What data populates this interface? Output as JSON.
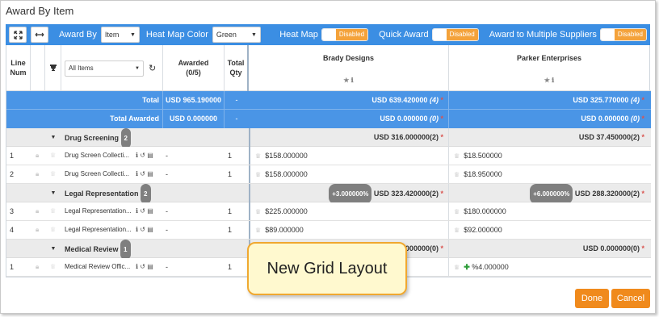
{
  "window": {
    "title": "Award By Item"
  },
  "toolbar": {
    "award_by_label": "Award By",
    "award_by_value": "Item",
    "heat_map_color_label": "Heat Map Color",
    "heat_map_color_value": "Green",
    "toggles": [
      {
        "label": "Heat Map",
        "state": "Disabled"
      },
      {
        "label": "Quick Award",
        "state": "Disabled"
      },
      {
        "label": "Award to Multiple Suppliers",
        "state": "Disabled"
      }
    ]
  },
  "grid": {
    "headers": {
      "line_num": "Line Num",
      "filter_value": "All Items",
      "awarded": "Awarded",
      "awarded_count": "(0/5)",
      "total_qty": "Total Qty"
    },
    "suppliers": [
      "Brady Designs",
      "Parker Enterprises"
    ],
    "total_row": {
      "label": "Total",
      "value": "USD 965.190000",
      "qty": "-",
      "suppliers": [
        "USD 639.420000",
        "USD 325.770000"
      ],
      "supplier_counts": [
        "(4)",
        "(4)"
      ]
    },
    "total_awarded_row": {
      "label": "Total Awarded",
      "value": "USD 0.000000",
      "qty": "-",
      "suppliers": [
        "USD 0.000000",
        "USD 0.000000"
      ],
      "supplier_counts": [
        "(0)",
        "(0)"
      ]
    },
    "groups": [
      {
        "name": "Drug Screening",
        "count": "2",
        "supplier_totals": [
          "USD 316.000000(2)",
          "USD 37.450000(2)"
        ],
        "supplier_badges": [
          "",
          ""
        ],
        "items": [
          {
            "line": "1",
            "name": "Drug Screen Collecti...",
            "awarded": "-",
            "qty": "1",
            "prices": [
              "$158.000000",
              "$18.500000"
            ]
          },
          {
            "line": "2",
            "name": "Drug Screen Collecti...",
            "awarded": "-",
            "qty": "1",
            "prices": [
              "$158.000000",
              "$18.950000"
            ]
          }
        ]
      },
      {
        "name": "Legal Representation",
        "count": "2",
        "supplier_totals": [
          "USD 323.420000(2)",
          "USD 288.320000(2)"
        ],
        "supplier_badges": [
          "+3.000000%",
          "+6.000000%"
        ],
        "items": [
          {
            "line": "3",
            "name": "Legal Representation...",
            "awarded": "-",
            "qty": "1",
            "prices": [
              "$225.000000",
              "$180.000000"
            ]
          },
          {
            "line": "4",
            "name": "Legal Representation...",
            "awarded": "-",
            "qty": "1",
            "prices": [
              "$89.000000",
              "$92.000000"
            ]
          }
        ]
      },
      {
        "name": "Medical Review",
        "count": "1",
        "supplier_totals": [
          "0.000000(0)",
          "USD 0.000000(0)"
        ],
        "supplier_badges": [
          "",
          ""
        ],
        "items": [
          {
            "line": "1",
            "name": "Medical Review Offic...",
            "awarded": "-",
            "qty": "1",
            "prices": [
              "",
              "%4.000000"
            ]
          }
        ]
      }
    ]
  },
  "callout": {
    "text": "New Grid Layout"
  },
  "actions": {
    "done": "Done",
    "cancel": "Cancel"
  },
  "colors": {
    "header_blue": "#4a95e6",
    "toolbar_blue": "#3b8ee3",
    "accent_orange": "#f08a1c",
    "toggle_orange": "#f4a23a"
  }
}
